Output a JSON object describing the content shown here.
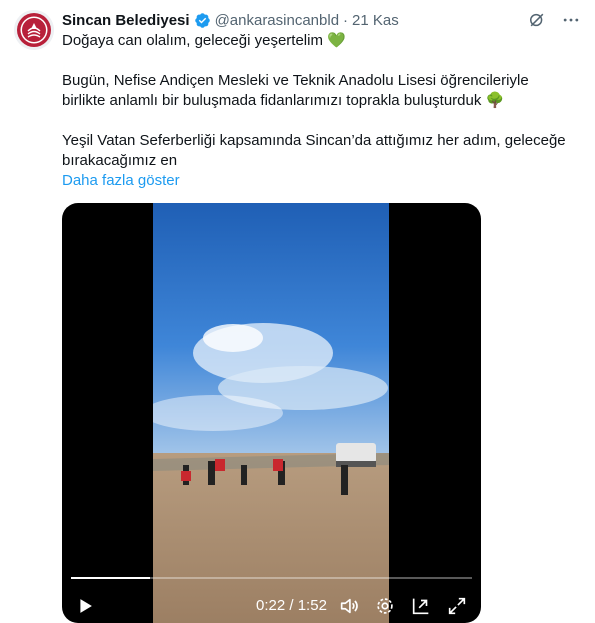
{
  "tweet": {
    "author": "Sincan Belediyesi",
    "handle": "@ankarasincanbld",
    "separator": "·",
    "time": "21 Kas",
    "text_lines": [
      "Doğaya can olalım, geleceği yeşertelim 💚",
      "Bugün, Nefise Andiçen Mesleki ve Teknik Anadolu Lisesi öğrencileriyle",
      "birlikte anlamlı bir buluşmada fidanlarımızı toprakla buluşturduk 🌳",
      "Yeşil Vatan Seferberliği kapsamında Sincan’da attığımız her adım, geleceğe",
      "bırakacağımız en"
    ],
    "show_more": "Daha fazla göster"
  },
  "video": {
    "current_time": "0:22",
    "duration": "1:52",
    "time_separator": "/",
    "progress": 0.196
  },
  "colors": {
    "accent": "#1d9bf0",
    "verified": "#1d9bf0",
    "muted": "#536471",
    "logo_red": "#b8203a"
  },
  "icons": [
    "grok-icon",
    "more-icon",
    "verified-badge-icon",
    "play-icon",
    "volume-icon",
    "settings-icon",
    "pip-icon",
    "fullscreen-icon"
  ]
}
